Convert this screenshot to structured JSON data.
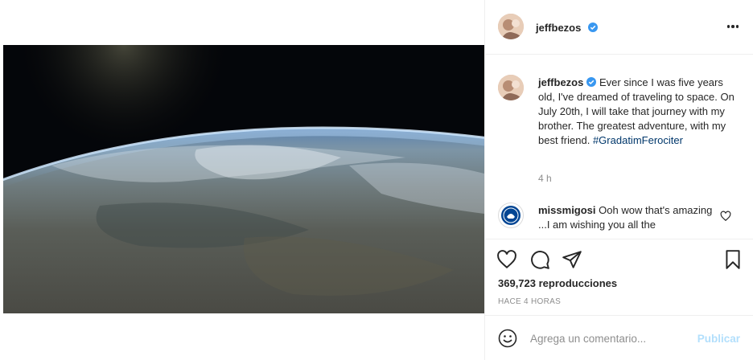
{
  "post": {
    "author": "jeffbezos",
    "caption_text": "Ever since I was five years old, I've dreamed of traveling to space. On July 20th, I will take that journey with my brother. The greatest adventure, with my best friend.",
    "hashtag": "#GradatimFerociter",
    "caption_time": "4 h",
    "views": "369,723 reproducciones",
    "posted_ago": "HACE 4 HORAS"
  },
  "comments": [
    {
      "author": "missmigosi",
      "text": "Ooh wow that's amazing ...I am wishing you all the"
    }
  ],
  "add_comment": {
    "placeholder": "Agrega un comentario...",
    "publish_label": "Publicar"
  },
  "icons": {
    "verified": "verified-badge-icon",
    "more": "more-options-icon",
    "like": "heart-icon",
    "comment": "comment-icon",
    "share": "paper-plane-icon",
    "save": "bookmark-icon",
    "mute": "speaker-muted-icon",
    "emoji": "smiley-icon"
  },
  "colors": {
    "verified": "#3897f0",
    "hashtag": "#00376b",
    "publish_disabled": "#b2dffc",
    "muted_text": "#8e8e8e"
  }
}
